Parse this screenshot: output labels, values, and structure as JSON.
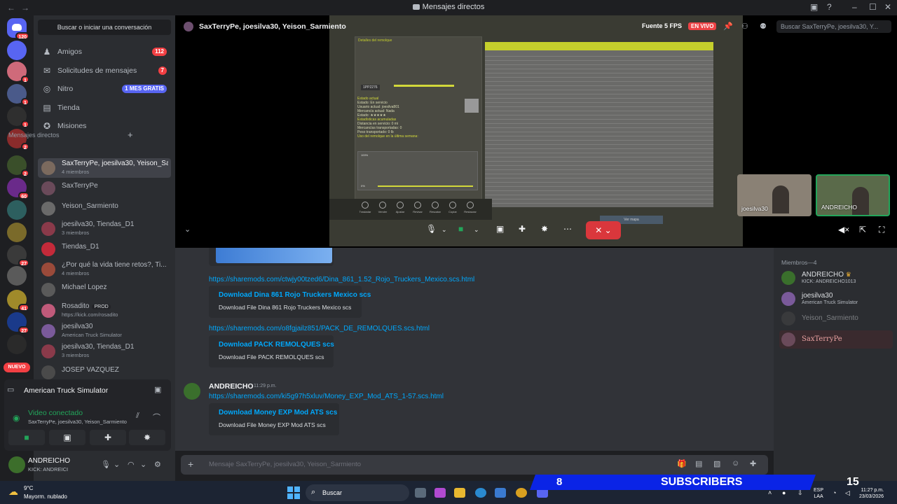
{
  "window": {
    "title": "Mensajes directos",
    "back": "←",
    "forward": "→"
  },
  "rail": {
    "home_badge": "120",
    "servers": [
      {
        "color": "#5865f2",
        "badge": ""
      },
      {
        "color": "#cf6a7a",
        "badge": "1"
      },
      {
        "color": "#4a5a8a",
        "badge": "1"
      },
      {
        "color": "#2f2f2f",
        "badge": "1"
      },
      {
        "color": "#8a2b2b",
        "badge": "2"
      },
      {
        "color": "#3a4f2a",
        "badge": "2"
      },
      {
        "color": "#6a2a8a",
        "badge": "60"
      },
      {
        "color": "#2d5f5f",
        "badge": ""
      },
      {
        "color": "#7a6a2a",
        "badge": ""
      },
      {
        "color": "#3a3a3a",
        "badge": "27"
      },
      {
        "color": "#5a5a5a",
        "badge": ""
      },
      {
        "color": "#a08a2a",
        "badge": "41"
      },
      {
        "color": "#1a3a8a",
        "badge": "27"
      },
      {
        "color": "#2a2a2a",
        "badge": ""
      }
    ],
    "new_label": "NUEVO"
  },
  "sidebar": {
    "search_label": "Buscar o iniciar una conversación",
    "nav": [
      {
        "label": "Amigos",
        "badge": "112"
      },
      {
        "label": "Solicitudes de mensajes",
        "badge": "7"
      },
      {
        "label": "Nitro",
        "badge": "1 MES GRATIS"
      },
      {
        "label": "Tienda",
        "badge": ""
      },
      {
        "label": "Misiones",
        "badge": ""
      }
    ],
    "dm_header": "Mensajes directos",
    "dms": [
      {
        "name": "SaxTerryPe, joesilva30, Yeison_Sarmiento",
        "sub": "4 miembros",
        "color": "#7b6a5e"
      },
      {
        "name": "SaxTerryPe",
        "sub": "",
        "color": "#6a4a5a"
      },
      {
        "name": "Yeison_Sarmiento",
        "sub": "",
        "color": "#6a6a6a"
      },
      {
        "name": "joesilva30, Tiendas_D1",
        "sub": "3 miembros",
        "color": "#8a3a4a"
      },
      {
        "name": "Tiendas_D1",
        "sub": "",
        "color": "#c42a3a"
      },
      {
        "name": "¿Por qué la vida tiene retos?, Ti...",
        "sub": "4 miembros",
        "color": "#9a4a3a"
      },
      {
        "name": "Michael Lopez",
        "sub": "",
        "color": "#5a5a5a"
      },
      {
        "name": "Rosadito",
        "sub": "https://kick.com/rosadito",
        "color": "#c05a7a",
        "prod": "PROD"
      },
      {
        "name": "joesilva30",
        "sub": "American Truck Simulator",
        "color": "#7a5a9a"
      },
      {
        "name": "joesilva30, Tiendas_D1",
        "sub": "3 miembros",
        "color": "#8a3a4a"
      },
      {
        "name": "JOSEP VAZQUEZ",
        "sub": "",
        "color": "#4a4a4a"
      }
    ]
  },
  "voice_panel": {
    "game": "American Truck Simulator",
    "status": "Video conectado",
    "channel": "SaxTerryPe, joesilva30, Yeison_Sarmiento"
  },
  "user_panel": {
    "name": "ANDREICHO",
    "status": "KICK: ANDREICI"
  },
  "stage": {
    "title": "SaxTerryPe, joesilva30, Yeison_Sarmiento",
    "fps": "Fuente 5 FPS",
    "live": "EN VIVO",
    "search_placeholder": "Buscar SaxTerryPe, joesilva30, Y...",
    "game_panel_title": "Detalles del remolque",
    "game_id": "1PP2276",
    "game_status": [
      "Estado actual",
      "Estado: En servicio",
      "Usuario actual: joesilva801",
      "Mercancía actual: Nada",
      "Estado: ★★★★★",
      "Estadísticas acumuladas",
      "Distancia en servicio: 0 mi",
      "Mercancías transportadas: 0",
      "Peso transportado: 0 lb",
      "Uso del remolque en la última semana:"
    ],
    "game_pct_top": "100%",
    "game_pct_bottom": "0%",
    "game_map_btn": "Ver mapa",
    "game_bar_items": [
      "Trasladar",
      "Vender",
      "Ajustar",
      "Revisar",
      "Rescatar",
      "Copiar",
      "Restaurar"
    ],
    "cams": [
      {
        "label": "joesilva30",
        "color": "#8a8175"
      },
      {
        "label": "ANDREICHO",
        "color": "#5a6a4a"
      }
    ]
  },
  "chat": {
    "link1": "https://sharemods.com/ctwjy00tzed6/Dina_861_1.52_Rojo_Truckers_Mexico.scs.html",
    "embed1_title": "Download Dina 861 Rojo Truckers Mexico scs",
    "embed1_desc": "Download File Dina 861 Rojo Truckers Mexico scs",
    "link2": "https://sharemods.com/o8fgjailz851/PACK_DE_REMOLQUES.scs.html",
    "embed2_title": "Download PACK REMOLQUES scs",
    "embed2_desc": "Download File PACK REMOLQUES scs",
    "author": "ANDREICHO",
    "time": "11:29 p.m.",
    "link3": "https://sharemods.com/ki5g97h5xluv/Money_EXP_Mod_ATS_1-57.scs.html",
    "embed3_title": "Download Money EXP Mod ATS scs",
    "embed3_desc": "Download File Money EXP Mod ATS scs",
    "composer_placeholder": "Mensaje SaxTerryPe, joesilva30, Yeison_Sarmiento"
  },
  "members": {
    "header": "Miembros—4",
    "list": [
      {
        "name": "ANDREICHO",
        "sub": "KICK: ANDREICHO1013",
        "color": "#3a6f2c",
        "crown": "♛"
      },
      {
        "name": "joesilva30",
        "sub": "American Truck Simulator",
        "color": "#7a5a9a"
      },
      {
        "name": "Yeison_Sarmiento",
        "sub": "",
        "color": "#4a4a4a"
      },
      {
        "name": "SaxTerryPe",
        "sub": "",
        "color": "#6a4a5a"
      }
    ]
  },
  "taskbar": {
    "temp": "9°C",
    "weather": "Mayorm. nublado",
    "search": "Buscar",
    "subs_count": "8",
    "subs_label": "SUBSCRIBERS",
    "subs_goal": "15",
    "lang1": "ESP",
    "lang2": "LAA",
    "time": "11:2? p.m.",
    "date": "23/03/2026"
  },
  "colors": {
    "accent": "#5865f2",
    "online": "#23a55a",
    "danger": "#da373c",
    "link": "#00a8fc"
  }
}
